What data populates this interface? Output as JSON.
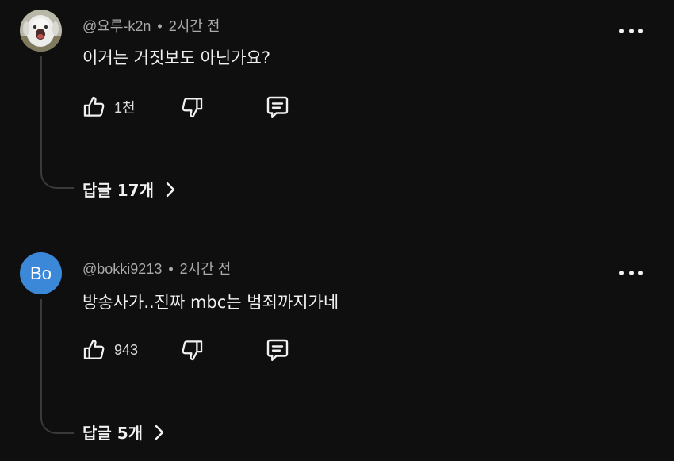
{
  "comments": [
    {
      "author": "@요루-k2n",
      "separator": "•",
      "time": "2시간 전",
      "text": "이거는 거짓보도 아닌가요?",
      "avatar_type": "photo",
      "likes": "1천",
      "replies_label": "답글 17개"
    },
    {
      "author": "@bokki9213",
      "separator": "•",
      "time": "2시간 전",
      "text": "방송사가..진짜 mbc는 범죄까지가네",
      "avatar_type": "initials",
      "avatar_initials": "Bo",
      "avatar_color": "#3b88d8",
      "likes": "943",
      "replies_label": "답글 5개"
    }
  ],
  "icons": {
    "like": "thumbs-up-icon",
    "dislike": "thumbs-down-icon",
    "reply": "comment-icon",
    "more": "more-icon",
    "expand": "chevron-right-icon"
  },
  "colors": {
    "background": "#0f0f0f",
    "text": "#f1f1f1",
    "meta": "#aaaaaa"
  }
}
